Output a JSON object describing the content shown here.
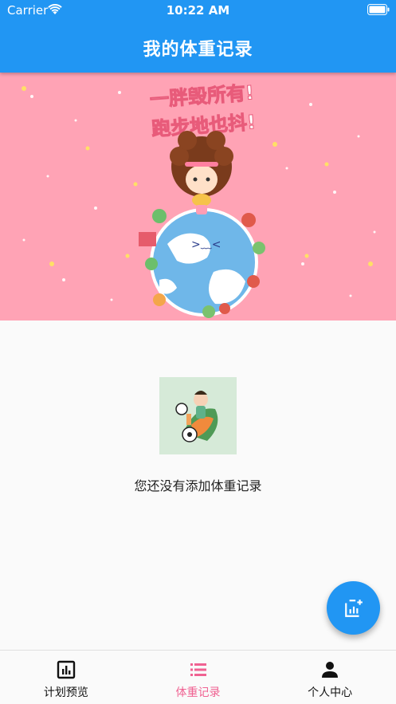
{
  "status_bar": {
    "carrier": "Carrier",
    "time": "10:22 AM"
  },
  "app_bar": {
    "title": "我的体重记录"
  },
  "banner": {
    "line1": "一胖毁所有!",
    "line2": "跑步地也抖!"
  },
  "empty_state": {
    "message": "您还没有添加体重记录"
  },
  "fab": {
    "icon": "add-chart-icon"
  },
  "bottom_nav": {
    "items": [
      {
        "label": "计划预览",
        "icon": "chart-icon",
        "active": false
      },
      {
        "label": "体重记录",
        "icon": "list-icon",
        "active": true
      },
      {
        "label": "个人中心",
        "icon": "person-icon",
        "active": false
      }
    ]
  },
  "colors": {
    "primary": "#2196f3",
    "accent": "#f06292",
    "banner": "#ffa3b5"
  }
}
